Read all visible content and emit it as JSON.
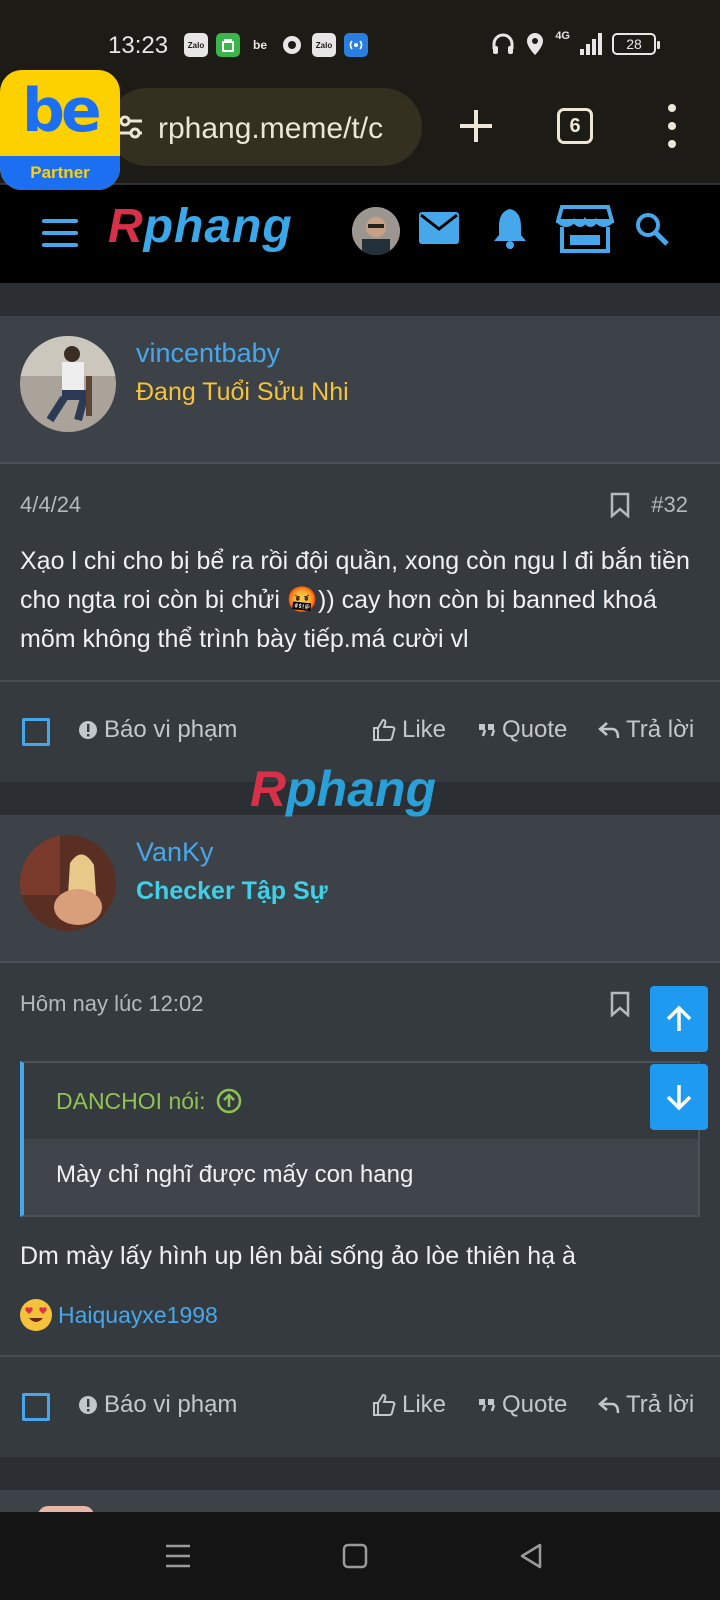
{
  "status_bar": {
    "time": "13:23",
    "apps": [
      "Zalo",
      "grab",
      "be",
      "dot",
      "Zalo",
      "signal"
    ],
    "network": "4G",
    "battery": "28"
  },
  "browser": {
    "url": "rphang.meme/t/c",
    "tabs_count": "6"
  },
  "be_badge": {
    "logo": "be",
    "label": "Partner"
  },
  "site": {
    "logo_r": "R",
    "logo_rest": "phang",
    "watermark_r": "R",
    "watermark_rest": "phang"
  },
  "posts": [
    {
      "author": "vincentbaby",
      "author_title": "Đang Tuổi Sửu Nhi",
      "title_color": "#f5c33b",
      "date": "4/4/24",
      "number": "#32",
      "body": "Xạo l chi cho bị bể ra rồi đội quần, xong còn ngu l đi bắn tiền cho ngta roi còn bị chửi 🤬)) cay hơn còn bị banned khoá mõm không thể trình bày tiếp.má cười vl",
      "actions": {
        "report": "Báo vi phạm",
        "like": "Like",
        "quote": "Quote",
        "reply": "Trả lời"
      }
    },
    {
      "author": "VanKy",
      "author_title": "Checker Tập Sự",
      "title_color": "#3fd0e8",
      "date": "Hôm nay lúc 12:02",
      "quote_author": "DANCHOI nói:",
      "quote_text": "Mày chỉ nghĩ được mấy con hang",
      "body": "Dm mày lấy hình up lên bài sống ảo lòe thiên hạ à",
      "reaction_user": "Haiquayxe1998",
      "actions": {
        "report": "Báo vi phạm",
        "like": "Like",
        "quote": "Quote",
        "reply": "Trả lời"
      }
    }
  ],
  "colors": {
    "accent": "#47a7eb",
    "background": "#2b2f33",
    "scroll_button": "#1e9bf0"
  }
}
